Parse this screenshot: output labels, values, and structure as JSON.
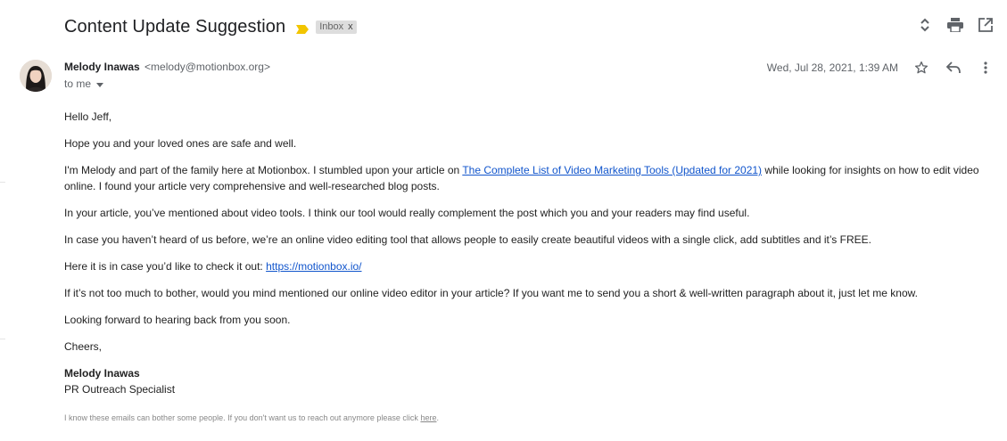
{
  "subject": "Content Update Suggestion",
  "label": "Inbox",
  "label_remove": "x",
  "colors": {
    "importance": "#f2c500",
    "link": "#1155cc"
  },
  "top_icons": [
    "expand-collapse-icon",
    "print-icon",
    "open-new-window-icon"
  ],
  "sender": {
    "name": "Melody Inawas",
    "email": "<melody@motionbox.org>",
    "to": "to me"
  },
  "date": "Wed, Jul 28, 2021, 1:39 AM",
  "message_icons": [
    "star-icon",
    "reply-icon",
    "more-vert-icon"
  ],
  "body": {
    "greeting": "Hello Jeff,",
    "p1": "Hope you and your loved ones are safe and well.",
    "p2_before": "I'm Melody and part of the family here at Motionbox. I stumbled upon your article on ",
    "p2_link": "The Complete List of Video Marketing Tools (Updated for 2021)",
    "p2_after": " while looking for insights on how to edit video online. I found your article very comprehensive and well-researched blog posts.",
    "p3": "In your article, you’ve mentioned about video tools. I think our tool would really complement the post which you and your readers may find useful.",
    "p4": "In case you haven’t heard of us before, we’re an online video editing tool that allows people to easily create beautiful videos with a single click, add subtitles and it’s FREE.",
    "p5_before": "Here it is in case you’d like to check it out: ",
    "p5_link": "https://motionbox.io/",
    "p6": "If it’s not too much to bother, would you mind mentioned our online video editor in your article? If you want me to send you a short & well-written paragraph about it, just let me know.",
    "p7": "Looking forward to hearing back from you soon.",
    "closing": "Cheers,",
    "sig_name": "Melody Inawas",
    "sig_title": "PR Outreach Specialist",
    "footer_before": "I know these emails can bother some people. If you don't want us to reach out anymore please click ",
    "footer_link": "here",
    "footer_after": "."
  }
}
